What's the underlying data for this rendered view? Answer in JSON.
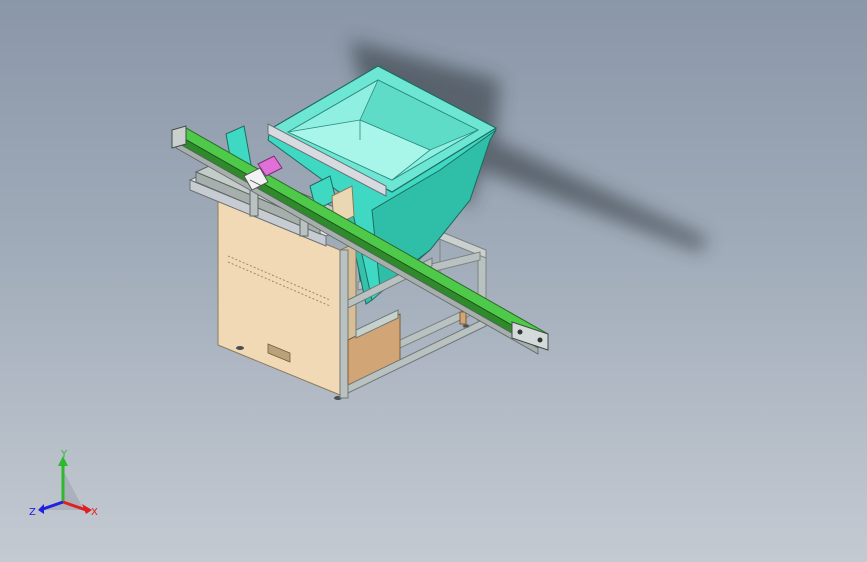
{
  "viewport": {
    "background_top": "#8a97a8",
    "background_bottom": "#c4cad2"
  },
  "model": {
    "hopper_color": "#3fd9c3",
    "hopper_inner_color": "#8ff0e2",
    "cabinet_color": "#f0d9b4",
    "frame_color": "#b9c2c0",
    "belt_color": "#4fc94a",
    "marker_color": "#e070d8"
  },
  "triad": {
    "x_label": "X",
    "y_label": "Y",
    "z_label": "Z",
    "x_color": "#e02020",
    "y_color": "#2db82d",
    "z_color": "#2020e0"
  }
}
